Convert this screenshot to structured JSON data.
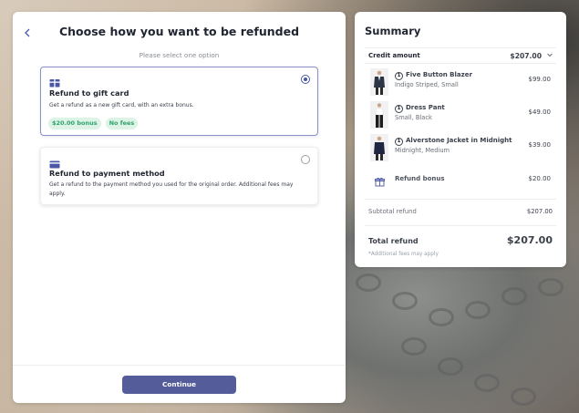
{
  "refund": {
    "back_icon": "chevron-left-icon",
    "title": "Choose how you want to be refunded",
    "subtitle": "Please select one option",
    "options": [
      {
        "icon": "gift-card-icon",
        "title": "Refund to gift card",
        "description": "Get a refund as a new gift card, with an extra bonus.",
        "chips": [
          "$20.00 bonus",
          "No fees"
        ],
        "selected": true
      },
      {
        "icon": "credit-card-icon",
        "title": "Refund to payment method",
        "description": "Get a refund to the payment method you used for the original order. Additional fees may apply.",
        "selected": false
      }
    ],
    "continue_label": "Continue"
  },
  "summary": {
    "title": "Summary",
    "credit_label": "Credit amount",
    "credit_value": "$207.00",
    "items": [
      {
        "qty": "1",
        "name": "Five Button Blazer",
        "variant": "Indigo Striped, Small",
        "price": "$99.00"
      },
      {
        "qty": "1",
        "name": "Dress Pant",
        "variant": "Small, Black",
        "price": "$49.00"
      },
      {
        "qty": "1",
        "name": "Alverstone Jacket in Midnight",
        "variant": "Midnight, Medium",
        "price": "$39.00"
      }
    ],
    "bonus_label": "Refund bonus",
    "bonus_value": "$20.00",
    "subtotal_label": "Subtotal refund",
    "subtotal_value": "$207.00",
    "total_label": "Total refund",
    "total_value": "$207.00",
    "note": "*Additional fees may apply"
  },
  "colors": {
    "accent": "#4a56a6",
    "button": "#545d9a",
    "chip_text": "#2fa36b",
    "chip_bg": "#dcf3e6"
  }
}
